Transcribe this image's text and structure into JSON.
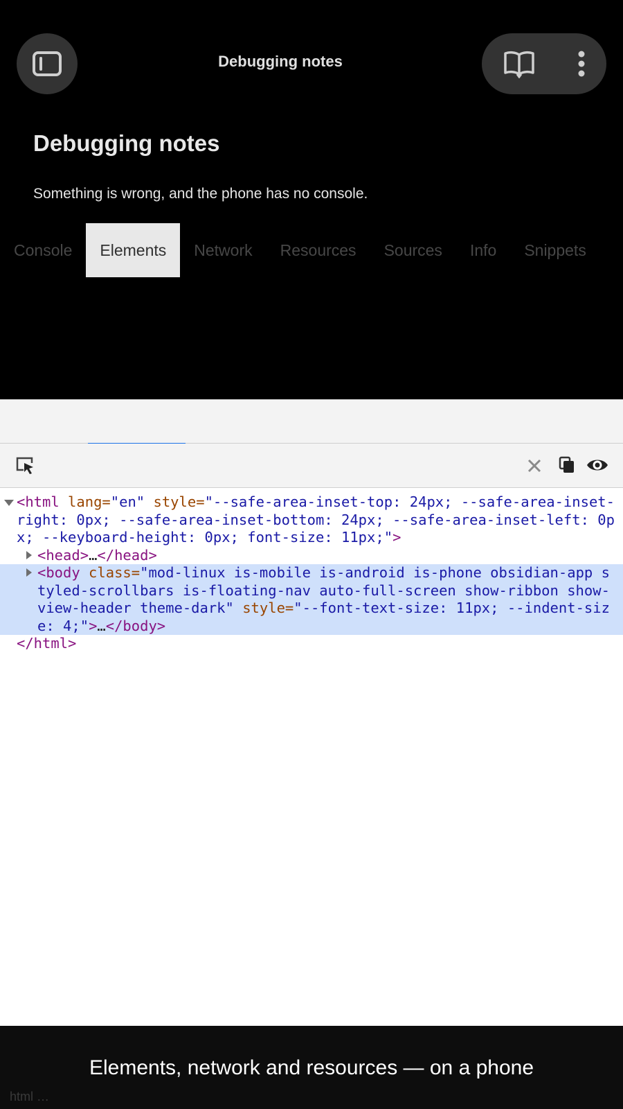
{
  "app": {
    "title": "Debugging notes"
  },
  "note": {
    "heading": "Debugging notes",
    "body": "Something is wrong, and the phone has no console."
  },
  "tabs": [
    {
      "label": "Console"
    },
    {
      "label": "Elements",
      "active": true
    },
    {
      "label": "Network"
    },
    {
      "label": "Resources"
    },
    {
      "label": "Sources"
    },
    {
      "label": "Info"
    },
    {
      "label": "Snippets"
    }
  ],
  "icons": {
    "sidebar": "sidebar-toggle-icon",
    "reading": "book-open-icon",
    "more": "more-vertical-icon",
    "pick": "element-picker-icon",
    "clear": "close-icon",
    "copy": "copy-icon",
    "eye": "eye-icon"
  },
  "dom_tree": {
    "html_open": {
      "tag_open": "<html",
      "lang_name": " lang=",
      "lang_value": "\"en\"",
      "style_name": " style=",
      "style_value": "\"--safe-area-inset-top: 24px; --safe-area-inset-right: 0px; --safe-area-inset-bottom: 24px; --safe-area-inset-left: 0px; --keyboard-height: 0px; font-size: 11px;\"",
      "tag_close": ">"
    },
    "head": {
      "tag_open": "<head>",
      "ellipsis": "…",
      "tag_close": "</head>"
    },
    "body": {
      "tag_open": "<body",
      "class_name": " class=",
      "class_value": "\"mod-linux is-mobile is-android is-phone obsidian-app styled-scrollbars is-floating-nav auto-full-screen show-ribbon show-view-header theme-dark\"",
      "style_name": " style=",
      "style_value": "\"--font-text-size: 11px; --indent-size: 4;\"",
      "tag_gt": ">",
      "ellipsis": "…",
      "tag_close": "</body>"
    },
    "html_close": "</html>"
  },
  "caption": {
    "text": "Elements, network and resources — on a phone",
    "crumb": "html  …"
  },
  "colors": {
    "tag": "#881280",
    "attr_name": "#994500",
    "attr_value": "#1a1aa6",
    "selection": "#cfe0fb",
    "active_tab_bg": "#e8e8e8"
  }
}
